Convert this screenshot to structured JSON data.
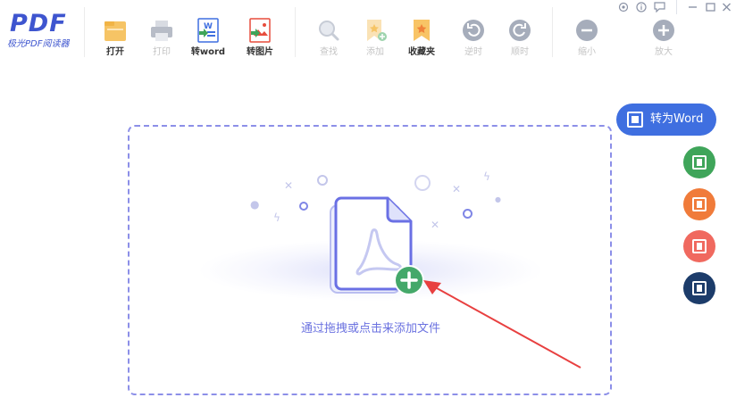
{
  "app": {
    "logo_mark": "PDF",
    "logo_sub": "极光PDF阅读器"
  },
  "toolbar": {
    "items": [
      {
        "label": "打开",
        "icon": "folder-icon",
        "enabled": true
      },
      {
        "label": "打印",
        "icon": "printer-icon",
        "enabled": false
      },
      {
        "label": "转word",
        "icon": "to-word-icon",
        "enabled": true
      },
      {
        "label": "转图片",
        "icon": "to-image-icon",
        "enabled": true
      },
      {
        "label": "查找",
        "icon": "search-icon",
        "enabled": false
      },
      {
        "label": "添加",
        "icon": "add-bookmark-icon",
        "enabled": false
      },
      {
        "label": "收藏夹",
        "icon": "bookmark-icon",
        "enabled": true
      },
      {
        "label": "逆时",
        "icon": "rotate-ccw-icon",
        "enabled": false
      },
      {
        "label": "顺时",
        "icon": "rotate-cw-icon",
        "enabled": false
      },
      {
        "label": "缩小",
        "icon": "zoom-out-icon",
        "enabled": false
      },
      {
        "label": "放大",
        "icon": "zoom-in-icon",
        "enabled": false
      }
    ]
  },
  "window_controls": {
    "settings_icon": "gear-icon",
    "info_icon": "info-icon",
    "feedback_icon": "chat-icon",
    "minimize_icon": "minimize-icon",
    "maximize_icon": "maximize-icon",
    "close_icon": "close-icon"
  },
  "dropzone": {
    "hint": "通过拖拽或点击来添加文件"
  },
  "side_actions": {
    "to_word_label": "转为Word",
    "buttons": [
      {
        "name": "to-excel",
        "color": "#3fa55a"
      },
      {
        "name": "to-ppt",
        "color": "#f07b3a"
      },
      {
        "name": "to-image",
        "color": "#f0695f"
      },
      {
        "name": "to-other",
        "color": "#1c3c6a"
      }
    ]
  },
  "colors": {
    "accent": "#3e55cf",
    "to_word_bg": "#3f6fe0",
    "dashed_border": "#8c8fe8",
    "plus_badge": "#44a86a",
    "arrow": "#e84040"
  }
}
